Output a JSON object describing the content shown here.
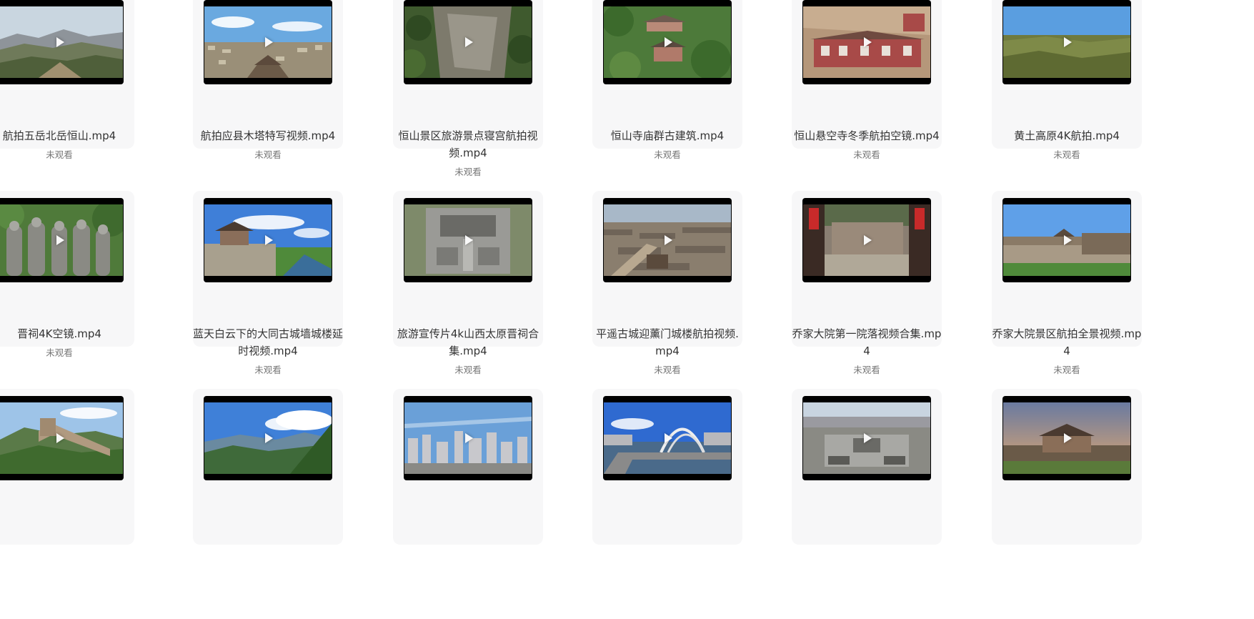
{
  "colors": {
    "tile_background": "#f7f7f8",
    "title_text": "#333333",
    "status_text": "#777777"
  },
  "videos": [
    {
      "title": "航拍五岳北岳恒山.mp4",
      "status": "未观看",
      "thumb": "mountain-ridge"
    },
    {
      "title": "航拍应县木塔特写视频.mp4",
      "status": "未观看",
      "thumb": "wooden-pagoda-town"
    },
    {
      "title": "恒山景区旅游景点寝宫航拍视频.mp4",
      "status": "未观看",
      "thumb": "cliff-forest"
    },
    {
      "title": "恒山寺庙群古建筑.mp4",
      "status": "未观看",
      "thumb": "temple-in-forest"
    },
    {
      "title": "恒山悬空寺冬季航拍空镜.mp4",
      "status": "未观看",
      "thumb": "hanging-temple"
    },
    {
      "title": "黄土高原4K航拍.mp4",
      "status": "未观看",
      "thumb": "loess-plateau"
    },
    {
      "title": "晋祠4K空镜.mp4",
      "status": "未观看",
      "thumb": "statues-trees"
    },
    {
      "title": "蓝天白云下的大同古城墙城楼延时视频.mp4",
      "status": "未观看",
      "thumb": "city-wall-tower"
    },
    {
      "title": "旅游宣传片4k山西太原晋祠合集.mp4",
      "status": "未观看",
      "thumb": "temple-courtyard-aerial"
    },
    {
      "title": "平遥古城迎薰门城楼航拍视频.mp4",
      "status": "未观看",
      "thumb": "ancient-city-rooftops"
    },
    {
      "title": "乔家大院第一院落视频合集.mp4",
      "status": "未观看",
      "thumb": "courtyard-red-lanterns"
    },
    {
      "title": "乔家大院景区航拍全景视频.mp4",
      "status": "未观看",
      "thumb": "compound-walls-sky"
    },
    {
      "title": "",
      "status": "",
      "thumb": "great-wall"
    },
    {
      "title": "",
      "status": "",
      "thumb": "green-mountains-clouds"
    },
    {
      "title": "",
      "status": "",
      "thumb": "modern-city"
    },
    {
      "title": "",
      "status": "",
      "thumb": "arch-bridge"
    },
    {
      "title": "",
      "status": "",
      "thumb": "square-city-aerial"
    },
    {
      "title": "",
      "status": "",
      "thumb": "city-gate-sunset"
    }
  ]
}
